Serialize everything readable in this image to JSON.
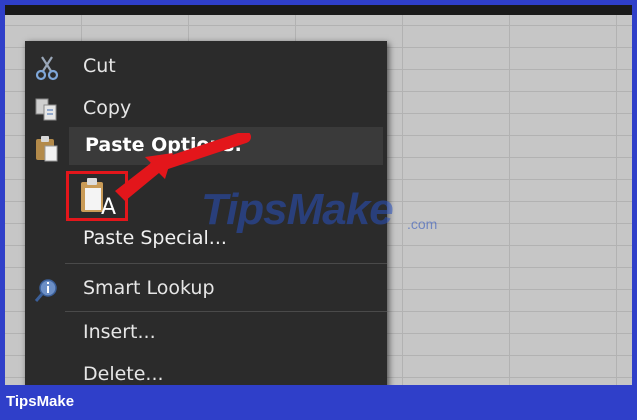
{
  "menu": {
    "cut": "Cut",
    "copy": "Copy",
    "paste_options": "Paste Options:",
    "paste_special": "Paste Special...",
    "smart_lookup": "Smart Lookup",
    "insert": "Insert...",
    "delete": "Delete..."
  },
  "icons": {
    "cut": "scissors-icon",
    "copy": "copy-icon",
    "paste": "clipboard-icon",
    "keep_text": "paste-keep-text-icon",
    "lookup": "smart-lookup-icon"
  },
  "watermark": {
    "name": "TipsMake",
    "suffix": ".com"
  },
  "footer": {
    "brand": "TipsMake"
  },
  "colors": {
    "frame": "#2f3fc9",
    "menu_bg": "#2b2b2b",
    "highlight": "#e3161b"
  }
}
